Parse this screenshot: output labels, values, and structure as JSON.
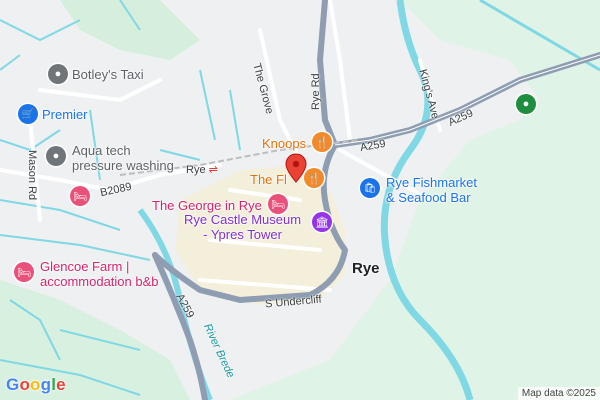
{
  "map": {
    "attribution": "Map data ©2025",
    "logo": "Google",
    "colors": {
      "road_major": "#8e9db1",
      "water": "#7fd8e4",
      "green": "#dff3e6",
      "town": "#f3efdb",
      "marker": "#ea4335"
    }
  },
  "places": [
    {
      "id": "botleys-taxi",
      "label": "Botley's Taxi",
      "icon": "taxi-pin-icon",
      "color": "#70757a"
    },
    {
      "id": "premier",
      "label": "Premier",
      "icon": "shopping-cart-icon",
      "color": "#1a73e8"
    },
    {
      "id": "aqua-tech",
      "label": "Aqua tech\npressure washing",
      "icon": "pin-icon",
      "color": "#70757a"
    },
    {
      "id": "knoops",
      "label": "Knoops",
      "icon": "cutlery-icon",
      "color": "#e8710a"
    },
    {
      "id": "the-fl",
      "label": "The Fl",
      "icon": "cutlery-icon",
      "color": "#e8710a"
    },
    {
      "id": "george-in-rye",
      "label": "The George in Rye",
      "icon": "bed-icon",
      "color": "#d6246e"
    },
    {
      "id": "rye-castle-museum",
      "label": "Rye Castle Museum\n- Ypres Tower",
      "icon": "museum-icon",
      "color": "#8430ce"
    },
    {
      "id": "rye-fishmarket",
      "label": "Rye Fishmarket\n& Seafood Bar",
      "icon": "shopping-bag-icon",
      "color": "#1a73e8"
    },
    {
      "id": "glencoe-farm",
      "label": "Glencoe Farm |\naccommodation b&b",
      "icon": "bed-icon",
      "color": "#d6246e"
    },
    {
      "id": "mason-rd-hotel",
      "label": "",
      "icon": "bed-icon",
      "color": "#d6246e"
    },
    {
      "id": "green-park",
      "label": "",
      "icon": "park-icon",
      "color": "#1e8e3e"
    }
  ],
  "roads": {
    "rye_rd": "Rye Rd",
    "the_grove": "The Grove",
    "kings_ave": "King's Ave",
    "a259_top": "A259",
    "a259_mid": "A259",
    "a259_bottom": "A259",
    "b2089": "B2089",
    "mason_rd": "Mason Rd",
    "s_undercliff": "S Undercliff",
    "river_brede": "River Brede"
  },
  "town": {
    "name": "Rye",
    "station": "Rye"
  }
}
